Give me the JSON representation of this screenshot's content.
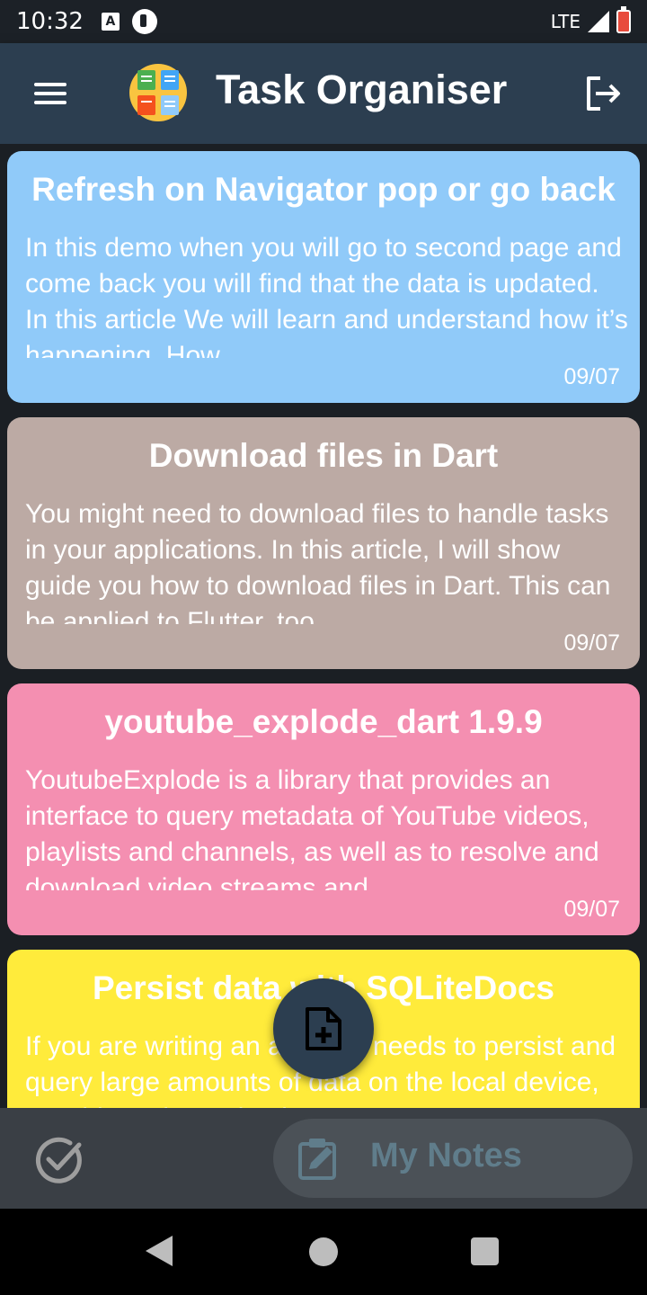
{
  "status_bar": {
    "time": "10:32",
    "notif_a": "A",
    "network": "LTE"
  },
  "app_bar": {
    "title": "Task Organiser",
    "menu_icon": "menu-icon",
    "logout_icon": "logout-icon"
  },
  "notes": [
    {
      "title": "Refresh on Navigator pop or go back",
      "body": "In this demo when you will go to second page and come back you will find that the data is updated. In this article We will learn and understand how it’s happening. How",
      "date": "09/07",
      "color": "#90caf9"
    },
    {
      "title": "Download files in Dart",
      "body": "You might need to download files to handle tasks in your applications. In this article, I will show guide you how to download files in Dart. This can be applied to Flutter, too.",
      "date": "09/07",
      "color": "#bcaaa4"
    },
    {
      "title": "youtube_explode_dart 1.9.9",
      "body": "YoutubeExplode is a library that provides an interface to query metadata of YouTube videos, playlists and channels, as well as to resolve and download video streams and",
      "date": "09/07",
      "color": "#f48fb1"
    },
    {
      "title": "Persist data with SQLiteDocs",
      "body": "If you are writing an app that needs to persist and query large amounts of data on the local device, consider using a database",
      "date": "",
      "color": "#ffeb3b"
    }
  ],
  "fab": {
    "icon": "add-note-icon"
  },
  "bottom_nav": {
    "done_icon": "check-circle-icon",
    "notes_label": "My Notes",
    "notes_icon": "edit-note-icon"
  },
  "colors": {
    "app_bar": "#2c3e50",
    "background": "#1b1f24",
    "bottom_bar": "#3a3f45",
    "notes_label": "#607d8b"
  }
}
